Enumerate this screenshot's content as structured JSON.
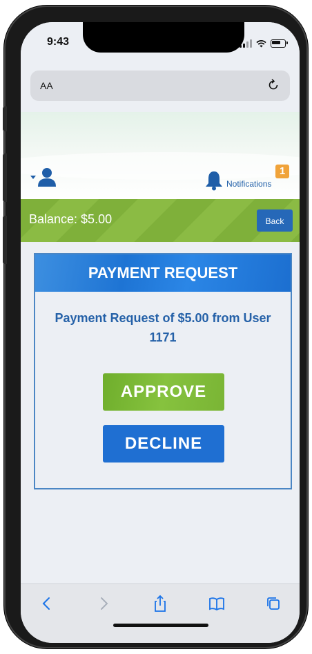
{
  "status_bar": {
    "time": "9:43"
  },
  "browser": {
    "address_aa": "AA"
  },
  "header": {
    "notifications_label": "Notifications",
    "notifications_count": "1"
  },
  "balance": {
    "text": "Balance: $5.00",
    "back_label": "Back"
  },
  "payment_request": {
    "title": "PAYMENT REQUEST",
    "message": "Payment Request of $5.00 from User 1171",
    "approve_label": "APPROVE",
    "decline_label": "DECLINE"
  },
  "colors": {
    "brand_blue": "#1f6fd2",
    "brand_green": "#7fb03a",
    "badge_orange": "#f0a33a",
    "text_blue": "#2561a8"
  },
  "icons": {
    "user": "user-icon",
    "bell": "bell-icon",
    "reload": "reload-icon",
    "back": "chevron-left-icon",
    "forward": "chevron-right-icon",
    "share": "share-icon",
    "bookmarks": "book-icon",
    "tabs": "tabs-icon"
  }
}
